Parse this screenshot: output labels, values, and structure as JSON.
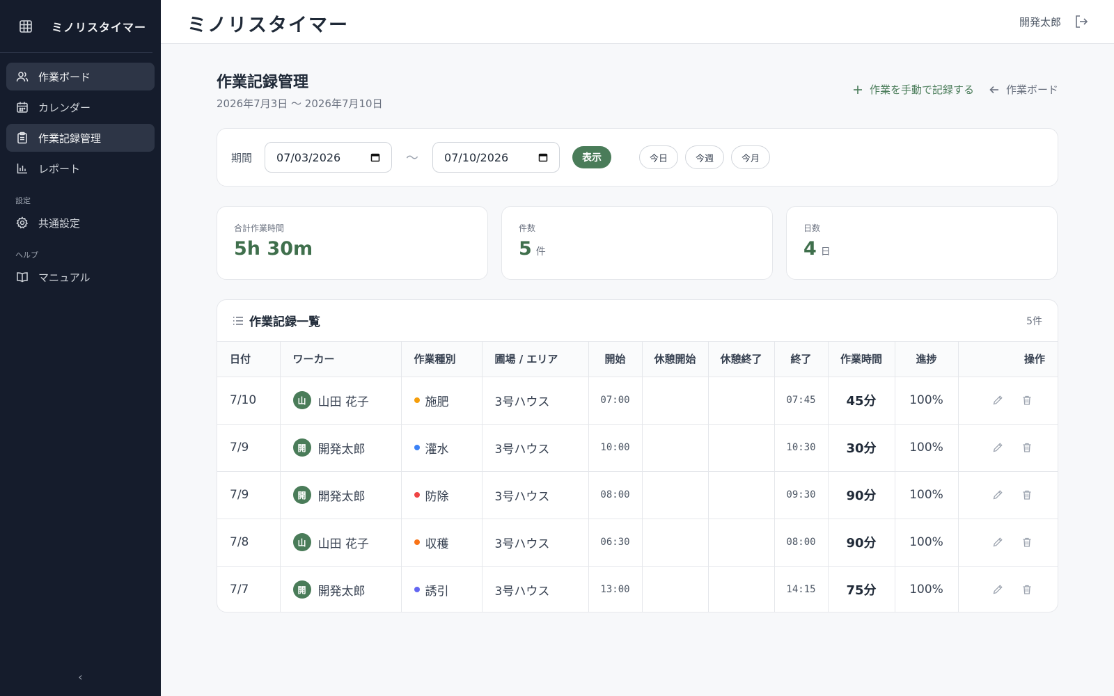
{
  "app": {
    "brand": "ミノリスタイマー"
  },
  "sidebar": {
    "items": [
      {
        "label": "作業ボード",
        "icon": "users-icon"
      },
      {
        "label": "カレンダー",
        "icon": "calendar-icon"
      },
      {
        "label": "作業記録管理",
        "icon": "clipboard-icon"
      },
      {
        "label": "レポート",
        "icon": "bar-chart-icon"
      }
    ],
    "section_settings": "設定",
    "settings_item": "共通設定",
    "section_help": "ヘルプ",
    "help_item": "マニュアル",
    "collapse": "‹"
  },
  "header": {
    "title": "ミノリスタイマー",
    "user": "開発太郎"
  },
  "page": {
    "title": "作業記録管理",
    "range": "2026年7月3日 〜 2026年7月10日",
    "add_manual": "作業を手動で記録する",
    "board_link": "作業ボード"
  },
  "filter": {
    "label": "期間",
    "start": "07/03/2026",
    "end": "07/10/2026",
    "tilde": "〜",
    "show": "表示",
    "today": "今日",
    "this_week": "今週",
    "this_month": "今月"
  },
  "stats": {
    "total_label": "合計作業時間",
    "total_value": "5h 30m",
    "count_label": "件数",
    "count_value": "5",
    "count_unit": "件",
    "days_label": "日数",
    "days_value": "4",
    "days_unit": "日"
  },
  "table": {
    "title": "作業記録一覧",
    "count": "5件",
    "columns": [
      "日付",
      "ワーカー",
      "作業種別",
      "圃場 / エリア",
      "開始",
      "休憩開始",
      "休憩終了",
      "終了",
      "作業時間",
      "進捗",
      "操作"
    ],
    "rows": [
      {
        "date": "7/10",
        "avatar": "山",
        "worker": "山田 花子",
        "type": "施肥",
        "type_color": "#f59e0b",
        "area": "3号ハウス",
        "start": "07:00",
        "break_start": "",
        "break_end": "",
        "end": "07:45",
        "duration": "45分",
        "progress": "100%"
      },
      {
        "date": "7/9",
        "avatar": "開",
        "worker": "開発太郎",
        "type": "灌水",
        "type_color": "#3b82f6",
        "area": "3号ハウス",
        "start": "10:00",
        "break_start": "",
        "break_end": "",
        "end": "10:30",
        "duration": "30分",
        "progress": "100%"
      },
      {
        "date": "7/9",
        "avatar": "開",
        "worker": "開発太郎",
        "type": "防除",
        "type_color": "#ef4444",
        "area": "3号ハウス",
        "start": "08:00",
        "break_start": "",
        "break_end": "",
        "end": "09:30",
        "duration": "90分",
        "progress": "100%"
      },
      {
        "date": "7/8",
        "avatar": "山",
        "worker": "山田 花子",
        "type": "収穫",
        "type_color": "#f97316",
        "area": "3号ハウス",
        "start": "06:30",
        "break_start": "",
        "break_end": "",
        "end": "08:00",
        "duration": "90分",
        "progress": "100%"
      },
      {
        "date": "7/7",
        "avatar": "開",
        "worker": "開発太郎",
        "type": "誘引",
        "type_color": "#6366f1",
        "area": "3号ハウス",
        "start": "13:00",
        "break_start": "",
        "break_end": "",
        "end": "14:15",
        "duration": "75分",
        "progress": "100%"
      }
    ]
  }
}
